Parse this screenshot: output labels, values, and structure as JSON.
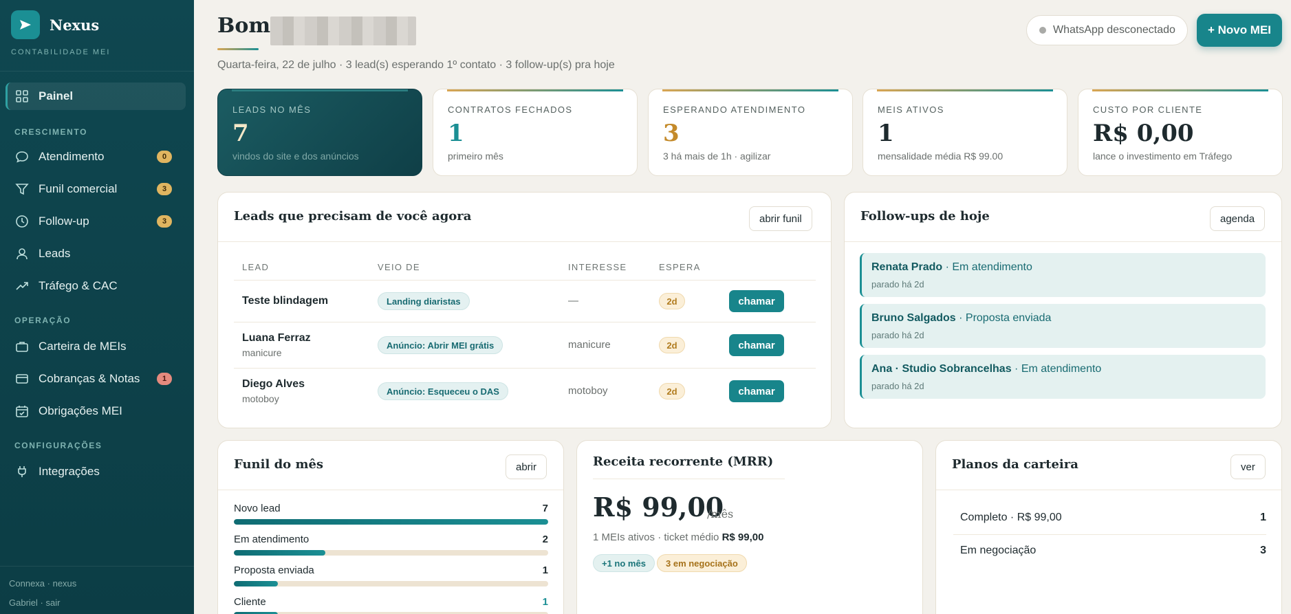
{
  "brand": {
    "name": "Nexus",
    "subtitle": "CONTABILIDADE MEI"
  },
  "nav": {
    "painel": "Painel",
    "section_crescimento": "CRESCIMENTO",
    "atendimento": "Atendimento",
    "atendimento_badge": "0",
    "funil": "Funil comercial",
    "funil_badge": "3",
    "followup": "Follow-up",
    "followup_badge": "3",
    "leads": "Leads",
    "trafego": "Tráfego & CAC",
    "section_operacao": "OPERAÇÃO",
    "carteira": "Carteira de MEIs",
    "cobrancas": "Cobranças & Notas",
    "cobrancas_badge": "1",
    "obrigacoes": "Obrigações MEI",
    "section_config": "CONFIGURAÇÕES",
    "integracoes": "Integrações"
  },
  "footer": {
    "line1": "Connexa · nexus",
    "line2": "Gabriel · sair"
  },
  "header": {
    "greeting": "Bom",
    "subtitle": "Quarta-feira, 22 de julho · 3 lead(s) esperando 1º contato · 3 follow-up(s) pra hoje",
    "whatsapp_status": "WhatsApp desconectado",
    "new_button": "+ Novo MEI"
  },
  "kpis": [
    {
      "label": "LEADS NO MÊS",
      "value": "7",
      "sub": "vindos do site e dos anúncios"
    },
    {
      "label": "CONTRATOS FECHADOS",
      "value": "1",
      "sub": "primeiro mês"
    },
    {
      "label": "ESPERANDO ATENDIMENTO",
      "value": "3",
      "sub": "3 há mais de 1h · agilizar"
    },
    {
      "label": "MEIS ATIVOS",
      "value": "1",
      "sub": "mensalidade média R$ 99.00"
    },
    {
      "label": "CUSTO POR CLIENTE",
      "value": "R$ 0,00",
      "sub": "lance o investimento em Tráfego"
    }
  ],
  "leads_panel": {
    "title": "Leads que precisam de você agora",
    "button": "abrir funil",
    "headers": [
      "LEAD",
      "VEIO DE",
      "INTERESSE",
      "ESPERA"
    ],
    "rows": [
      {
        "name": "Teste blindagem",
        "sub": "",
        "source": "Landing diaristas",
        "interest": "—",
        "wait": "2d",
        "action": "chamar"
      },
      {
        "name": "Luana Ferraz",
        "sub": "manicure",
        "source": "Anúncio: Abrir MEI grátis",
        "interest": "manicure",
        "wait": "2d",
        "action": "chamar"
      },
      {
        "name": "Diego Alves",
        "sub": "motoboy",
        "source": "Anúncio: Esqueceu o DAS",
        "interest": "motoboy",
        "wait": "2d",
        "action": "chamar"
      }
    ]
  },
  "followups": {
    "title": "Follow-ups de hoje",
    "button": "agenda",
    "items": [
      {
        "name": "Renata Prado",
        "status": " · Em atendimento",
        "sub": "parado há 2d"
      },
      {
        "name": "Bruno Salgados",
        "status": " · Proposta enviada",
        "sub": "parado há 2d"
      },
      {
        "name": "Ana · Studio Sobrancelhas",
        "status": " · Em atendimento",
        "sub": "parado há 2d"
      }
    ]
  },
  "funnel": {
    "title": "Funil do mês",
    "button": "abrir",
    "stages": [
      {
        "label": "Novo lead",
        "value": 7,
        "fraction": 1.0
      },
      {
        "label": "Em atendimento",
        "value": 2,
        "fraction": 0.29
      },
      {
        "label": "Proposta enviada",
        "value": 1,
        "fraction": 0.14
      },
      {
        "label": "Cliente",
        "value": 1,
        "fraction": 0.14
      }
    ]
  },
  "mrr": {
    "title": "Receita recorrente (MRR)",
    "value": "R$ 99,00",
    "unit": "/mês",
    "sub_prefix": "1 MEIs ativos · ticket médio ",
    "sub_value": "R$ 99,00",
    "tag1": "+1 no mês",
    "tag2": "3 em negociação"
  },
  "plans": {
    "title": "Planos da carteira",
    "button": "ver",
    "rows": [
      {
        "label": "Completo · R$ 99,00",
        "value": "1"
      },
      {
        "label": "Em negociação",
        "value": "3"
      }
    ]
  },
  "colors": {
    "accent": "#1b8f94",
    "sidebar": "#0f4750",
    "gold": "#d9a552"
  }
}
